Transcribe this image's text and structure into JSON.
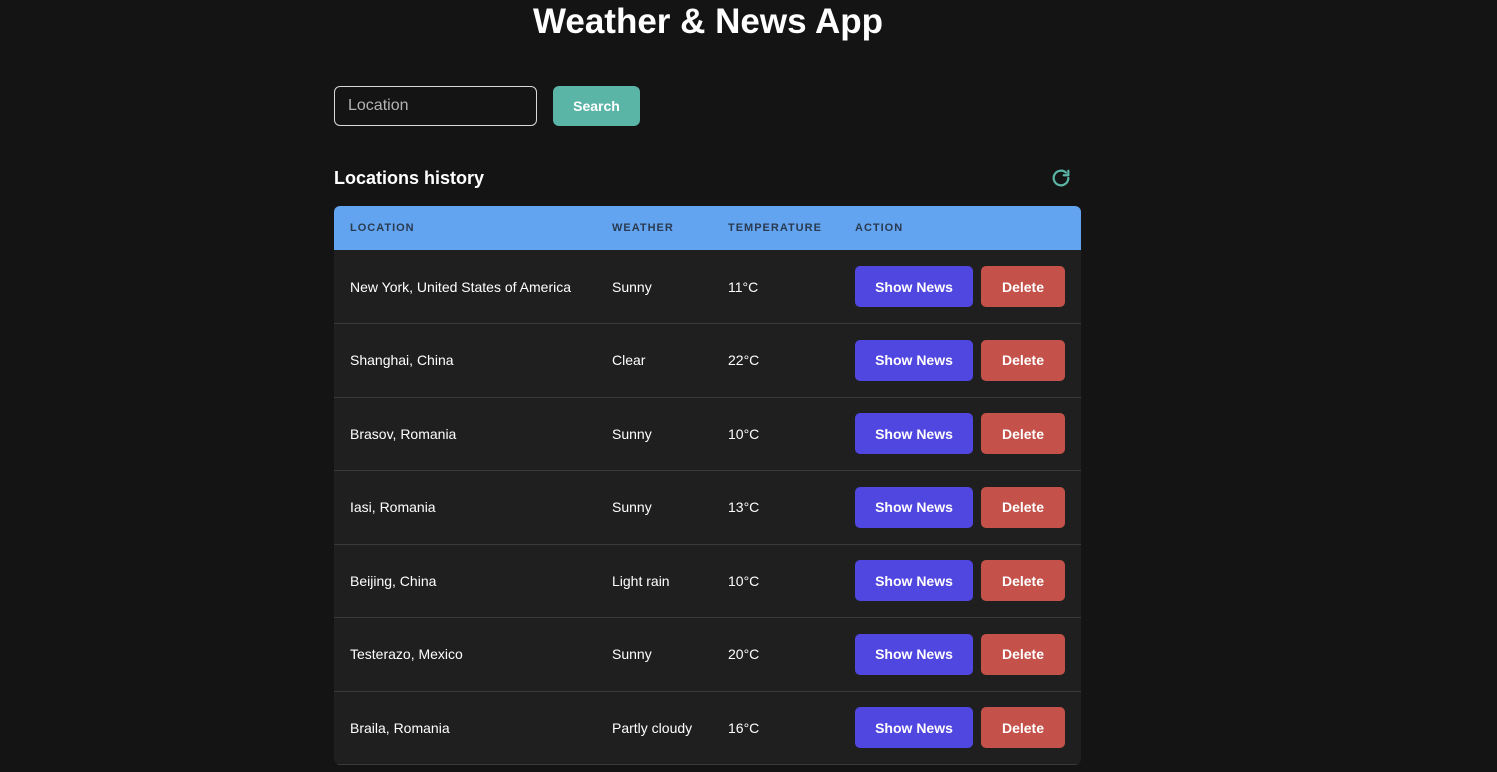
{
  "app": {
    "title": "Weather & News App"
  },
  "search": {
    "placeholder": "Location",
    "value": "",
    "button_label": "Search"
  },
  "history": {
    "title": "Locations history",
    "refresh_icon": "refresh-icon",
    "columns": [
      "LOCATION",
      "WEATHER",
      "TEMPERATURE",
      "ACTION"
    ],
    "rows": [
      {
        "location": "New York, United States of America",
        "weather": "Sunny",
        "temperature": "11°C",
        "news_label": "Show News",
        "delete_label": "Delete"
      },
      {
        "location": "Shanghai, China",
        "weather": "Clear",
        "temperature": "22°C",
        "news_label": "Show News",
        "delete_label": "Delete"
      },
      {
        "location": "Brasov, Romania",
        "weather": "Sunny",
        "temperature": "10°C",
        "news_label": "Show News",
        "delete_label": "Delete"
      },
      {
        "location": "Iasi, Romania",
        "weather": "Sunny",
        "temperature": "13°C",
        "news_label": "Show News",
        "delete_label": "Delete"
      },
      {
        "location": "Beijing, China",
        "weather": "Light rain",
        "temperature": "10°C",
        "news_label": "Show News",
        "delete_label": "Delete"
      },
      {
        "location": "Testerazo, Mexico",
        "weather": "Sunny",
        "temperature": "20°C",
        "news_label": "Show News",
        "delete_label": "Delete"
      },
      {
        "location": "Braila, Romania",
        "weather": "Partly cloudy",
        "temperature": "16°C",
        "news_label": "Show News",
        "delete_label": "Delete"
      }
    ]
  },
  "colors": {
    "background": "#141414",
    "accent_teal": "#5bb5a6",
    "header_blue": "#63a4f0",
    "news_button": "#5046e0",
    "delete_button": "#c4524b",
    "row_background": "#1f1f1f"
  }
}
